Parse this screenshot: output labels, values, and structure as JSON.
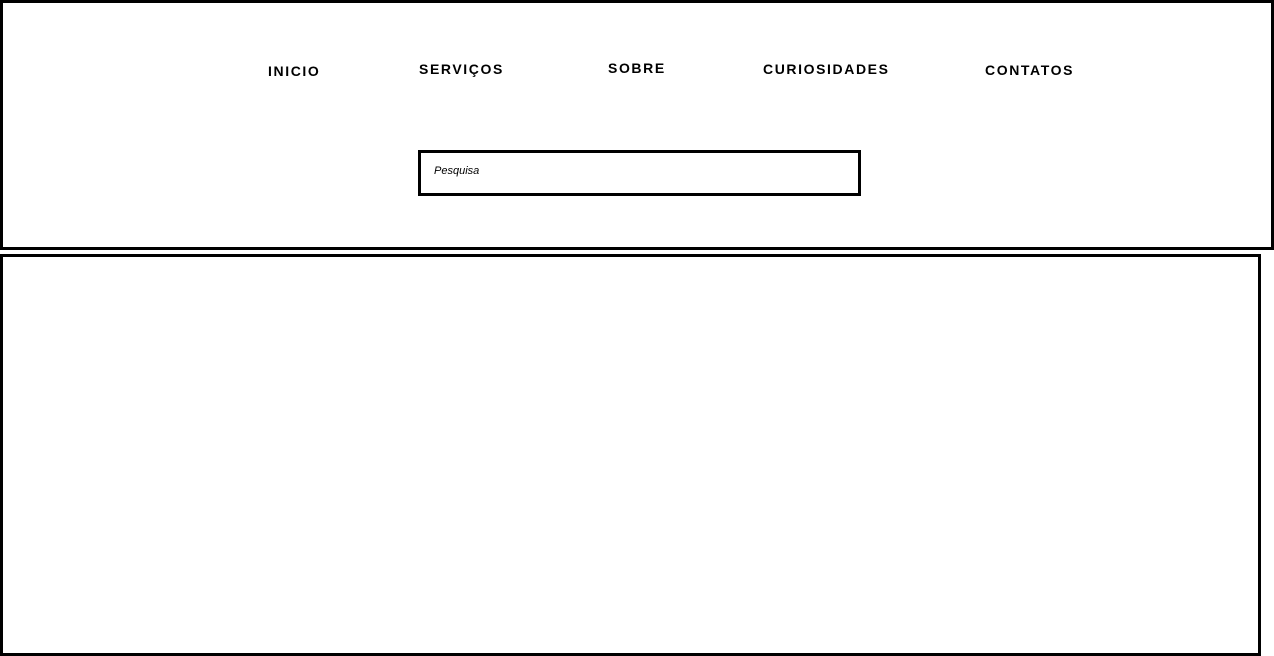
{
  "nav": {
    "items": [
      {
        "label": "INICIO"
      },
      {
        "label": "SERVIÇOS"
      },
      {
        "label": "SOBRE"
      },
      {
        "label": "CURIOSIDADES"
      },
      {
        "label": "CONTATOS"
      }
    ]
  },
  "search": {
    "placeholder": "Pesquisa",
    "value": ""
  },
  "colors": {
    "border": "#000000",
    "background": "#ffffff",
    "text": "#000000"
  }
}
